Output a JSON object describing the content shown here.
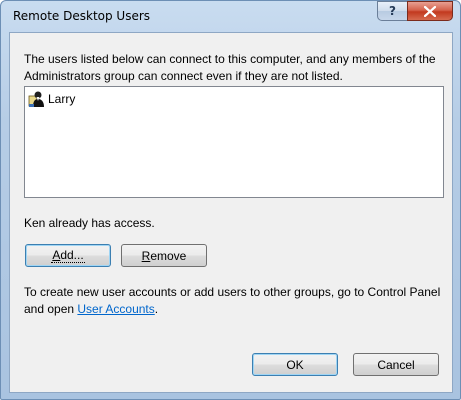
{
  "window": {
    "title": "Remote Desktop Users",
    "help_glyph": "?",
    "close_glyph": "✕"
  },
  "intro_text": "The users listed below can connect to this computer, and any members of the Administrators group can connect even if they are not listed.",
  "users": [
    {
      "name": "Larry",
      "icon": "user-icon"
    }
  ],
  "access_text": "Ken already has access.",
  "buttons": {
    "add": {
      "label": "Add...",
      "accel": "A",
      "rest": "dd..."
    },
    "remove": {
      "label": "Remove",
      "accel": "R",
      "rest": "emove"
    },
    "ok": "OK",
    "cancel": "Cancel"
  },
  "create_text": {
    "prefix": "To create new user accounts or add users to other groups, go to Control Panel and open ",
    "link": "User Accounts",
    "suffix": "."
  },
  "colors": {
    "link": "#0066cc",
    "close_button": "#c2391f",
    "frame": "#a9c3e0"
  }
}
